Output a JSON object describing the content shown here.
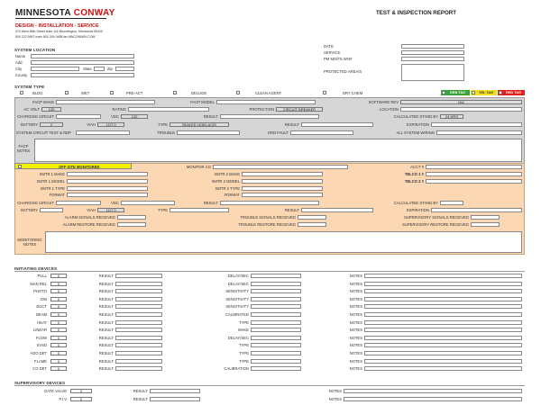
{
  "company": {
    "name1": "MINNESOTA",
    "name2": "CONWAY",
    "tagline": "DESIGN - INSTALLATION - SERVICE",
    "address": "374 West 86th Street suite 116 Bloomington, Minnesota 55420",
    "contact": "800 222 5697 main 800 349 0488 fax   MNCONWAY.COM"
  },
  "report_title": "TEST & INSPECTION REPORT",
  "system_location": {
    "heading": "SYSTEM LOCATION",
    "fields": [
      "Name",
      "Add.",
      "City",
      "State",
      "Zip",
      "County"
    ]
  },
  "right_fields": [
    "DATE",
    "SERVICE",
    "PM MO/FS WO#",
    "PROTECTED AREA/S"
  ],
  "system_type": {
    "heading": "SYSTEM TYPE",
    "options": [
      "BLDG",
      "WET",
      "PRE-ACT",
      "DELUGE",
      "CLEAN AGENT",
      "DRY CHEM"
    ],
    "tags": [
      {
        "label": "GRN TAG",
        "color": "#3aa33a"
      },
      {
        "label": "YEL TAG",
        "color": "#f0e020"
      },
      {
        "label": "RED TAG",
        "color": "#e02020"
      }
    ]
  },
  "facp": {
    "rows": [
      [
        "FACP MAKE",
        "FACP MODEL",
        "SOFTWARE REV"
      ],
      [
        "AC VOLT",
        "RATING",
        "PROTECTION",
        "LOCATION"
      ],
      [
        "CHARGING CIRCUIT",
        "VDC",
        "RESULT",
        "CALCULATED STAND BY"
      ],
      [
        "BATTERY",
        "V/AH",
        "TYPE",
        "RESULT",
        "EXPIRATION"
      ],
      [
        "SYSTEM CIRCUIT TEST & RDP",
        "TROUBLE",
        "GRD FAULT",
        "ALL SYSTEM WIRING"
      ]
    ],
    "values": {
      "software_rev": "N/A",
      "ac_volt": "120",
      "protection": "CIRCUIT BREAKER",
      "vdc": "120",
      "standby": "24 HRS",
      "battery": "2",
      "vah": "12/7.0",
      "type": "SEALED LEAD-ACID"
    },
    "notes_label": "FACP NOTES"
  },
  "monitoring": {
    "offsite": "OFF SITE MONITORED",
    "monitor_co": "MONITOR CO",
    "acct": "ACCT #",
    "xmtr_rows": [
      [
        "XMTR 1 MAKE",
        "XMTR 2 MAKE",
        "TELCO 1 #"
      ],
      [
        "XMTR 1 MODEL",
        "XMTR 2 MODEL",
        "TELCO 2 #"
      ],
      [
        "XMTR 1 TYPE",
        "XMTR 2 TYPE"
      ],
      [
        "FORMAT",
        "FORMAT"
      ]
    ],
    "charging": [
      "CHARGING CIRCUIT",
      "VDC",
      "RESULT",
      "CALCULATED STAND BY"
    ],
    "battery": [
      "BATTERY",
      "V/AH",
      "TYPE",
      "RESULT",
      "EXPIRATION"
    ],
    "vah": "12/7.0",
    "signal_rows": [
      [
        "ALARM SIGNALS RECEIVED",
        "TROUBLE SIGNALS RECEIVED",
        "SUPERVISORY SIGNALS RECEIVED"
      ],
      [
        "ALARM RESTORE RECEIVED",
        "TROUBLE RESTORE RECEIVED",
        "SUPERVISORY RESTORE RECEIVED"
      ]
    ],
    "notes_label": "MONITORING NOTES"
  },
  "initiating": {
    "heading": "INITIATING DEVICES",
    "devices": [
      {
        "name": "PULL",
        "qty": "0",
        "c3": "DELAY/SEC"
      },
      {
        "name": "MAN REL",
        "qty": "0",
        "c3": "DELAY/SEC"
      },
      {
        "name": "PHOTO",
        "qty": "0",
        "c3": "SENSITIVITY"
      },
      {
        "name": "ION",
        "qty": "0",
        "c3": "SENSITIVITY"
      },
      {
        "name": "DUCT",
        "qty": "0",
        "c3": "SENSITIVITY"
      },
      {
        "name": "BEAM",
        "qty": "0",
        "c3": "CALIBRATED"
      },
      {
        "name": "HEAT",
        "qty": "0",
        "c3": "TYPE"
      },
      {
        "name": "LINEAR",
        "qty": "0",
        "c3": "MAKE"
      },
      {
        "name": "FLOW",
        "qty": "0",
        "c3": "DELAY/SEC"
      },
      {
        "name": "SVSD",
        "qty": "0",
        "c3": "TYPE"
      },
      {
        "name": "H2O DET",
        "qty": "0",
        "c3": "TYPE"
      },
      {
        "name": "FLAME",
        "qty": "0",
        "c3": "TYPE"
      },
      {
        "name": "CO DET",
        "qty": "0",
        "c3": "CALIBRATION"
      }
    ],
    "result_label": "RESULT",
    "notes_label": "NOTES"
  },
  "supervisory": {
    "heading": "SUPERVISORY DEVICES",
    "devices": [
      {
        "name": "GATE VALVE",
        "qty": "0"
      },
      {
        "name": "P.I.V",
        "qty": "0"
      }
    ],
    "result_label": "RESULT",
    "notes_label": "NOTES"
  }
}
